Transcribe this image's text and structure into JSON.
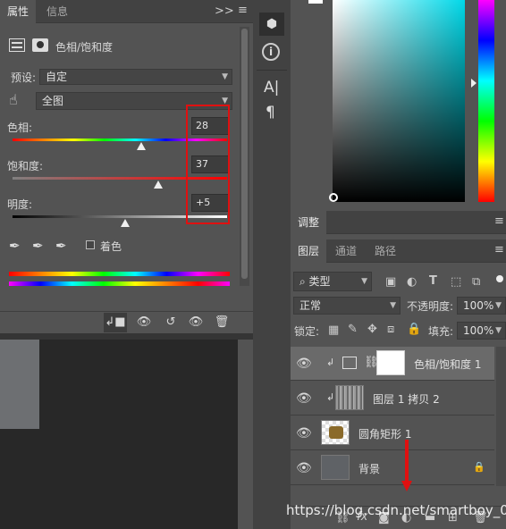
{
  "properties_panel": {
    "tabs": [
      "属性",
      "信息"
    ],
    "title": "色相/饱和度",
    "preset_label": "预设:",
    "preset_value": "自定",
    "channel_value": "全图",
    "hue_label": "色相:",
    "hue_value": "28",
    "hue_level": 0.6,
    "saturation_label": "饱和度:",
    "saturation_value": "37",
    "saturation_level": 0.68,
    "lightness_label": "明度:",
    "lightness_value": "+5",
    "lightness_level": 0.525,
    "colorize_label": "着色",
    "expand_icon": "double-chevron-right-icon",
    "menu_icon": "hamburger-menu-icon"
  },
  "mid_toolbar": {
    "text_tool_label": "A|",
    "paragraph_label": "¶"
  },
  "adjustments_panel": {
    "tab": "调整"
  },
  "layers_panel": {
    "tabs": [
      "图层",
      "通道",
      "路径"
    ],
    "filter_label": "类型",
    "blend_mode": "正常",
    "opacity_label": "不透明度:",
    "opacity_value": "100%",
    "lock_label": "锁定:",
    "fill_label": "填充:",
    "fill_value": "100%",
    "layers": [
      {
        "name": "色相/饱和度 1",
        "type": "adjustment",
        "clipped": true,
        "selected": true
      },
      {
        "name": "图层 1 拷贝 2",
        "type": "texture",
        "clipped": true,
        "selected": false
      },
      {
        "name": "圆角矩形 1",
        "type": "shape",
        "clipped": false,
        "selected": false
      },
      {
        "name": "背景",
        "type": "background",
        "clipped": false,
        "selected": false,
        "locked": true
      }
    ],
    "bottom_fx_label": "fx"
  },
  "watermark": "https://blog.csdn.net/smartboy_01",
  "colors": {
    "panel_bg": "#535353",
    "tab_bg": "#424242",
    "highlight_red": "#e01010",
    "selected_layer": "#6a6a6a"
  }
}
